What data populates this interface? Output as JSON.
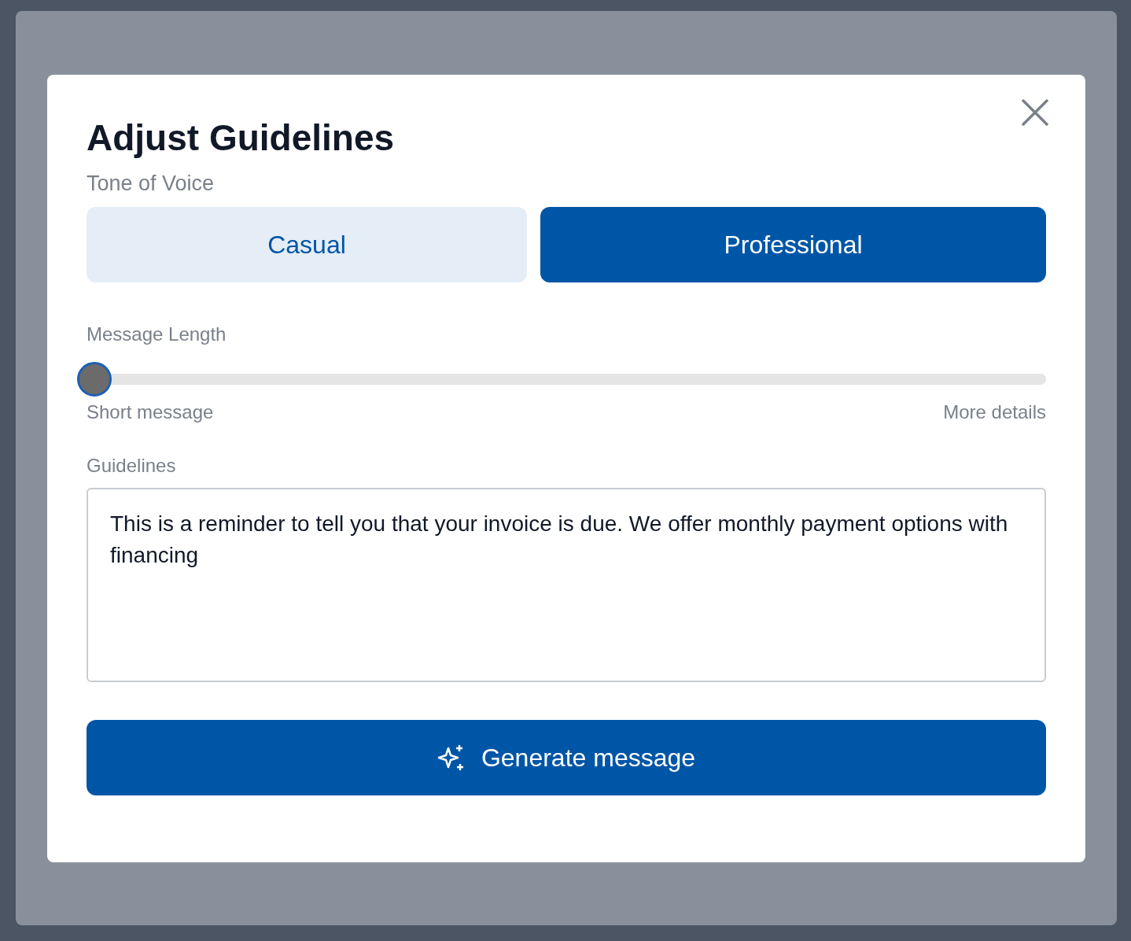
{
  "dialog": {
    "title": "Adjust Guidelines",
    "tone": {
      "label": "Tone of Voice",
      "options": [
        {
          "label": "Casual",
          "selected": false
        },
        {
          "label": "Professional",
          "selected": true
        }
      ]
    },
    "length": {
      "label": "Message Length",
      "level": 0,
      "min_label": "Short message",
      "max_label": "More details"
    },
    "guidelines": {
      "label": "Guidelines",
      "value": "This is a reminder to tell you that your invoice is due. We offer monthly payment options with financing"
    },
    "button": "Generate message"
  }
}
